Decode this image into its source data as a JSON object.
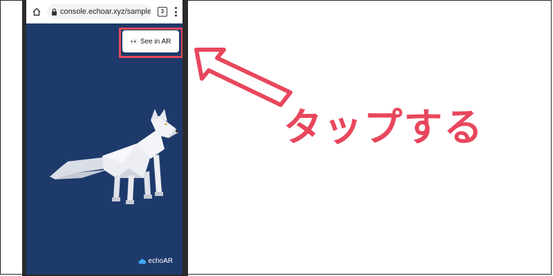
{
  "browser": {
    "url": "console.echoar.xyz/samples/w-",
    "tab_count": "3"
  },
  "viewer": {
    "ar_button_emoji": "👀",
    "ar_button_label": "See in AR",
    "brand_label": "echoAR",
    "background_color": "#1e3a6b"
  },
  "annotation": {
    "caption": "タップする",
    "accent_color": "#e8475c"
  }
}
